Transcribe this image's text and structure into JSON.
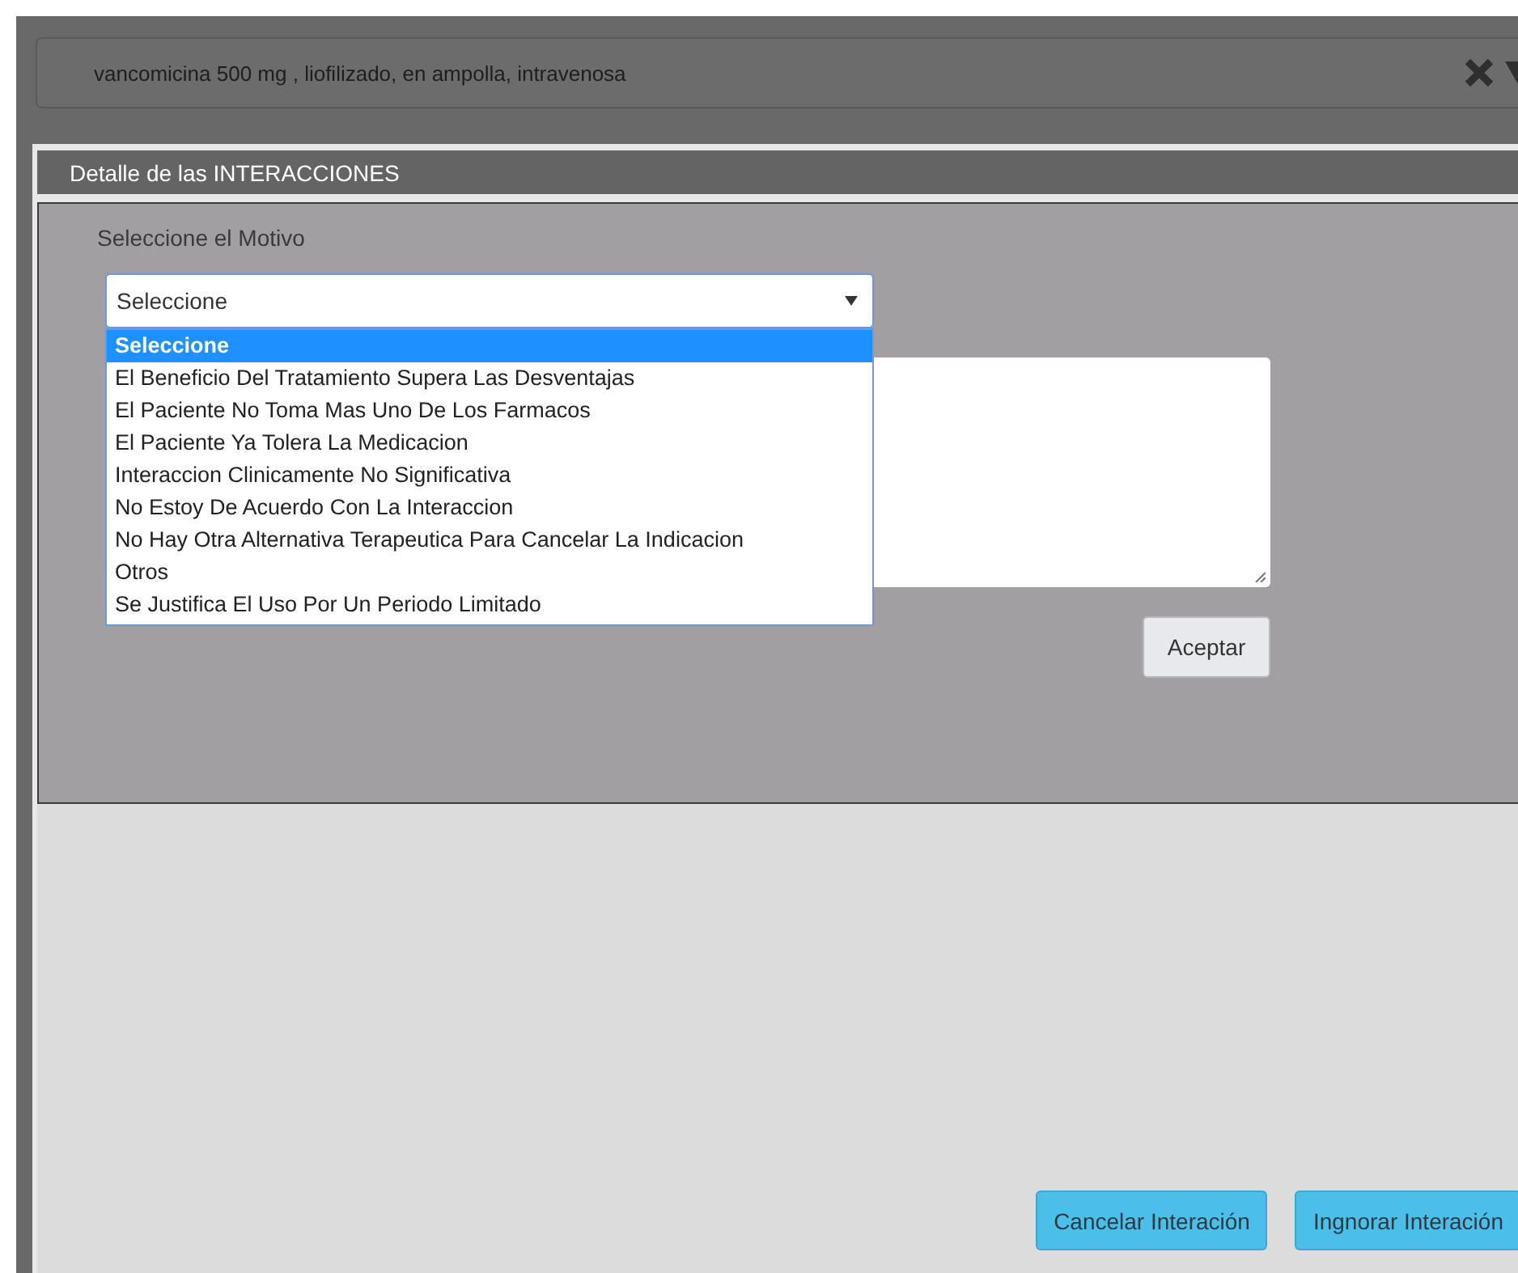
{
  "header": {
    "medication": "vancomicina 500 mg , liofilizado, en ampolla, intravenosa"
  },
  "dialog": {
    "title": "Detalle de las INTERACCIONES",
    "form": {
      "label": "Seleccione el Motivo",
      "select_value": "Seleccione",
      "options": [
        {
          "label": "Seleccione",
          "selected": true
        },
        {
          "label": "El Beneficio Del Tratamiento Supera Las Desventajas",
          "selected": false
        },
        {
          "label": "El Paciente No Toma Mas Uno De Los Farmacos",
          "selected": false
        },
        {
          "label": "El Paciente Ya Tolera La Medicacion",
          "selected": false
        },
        {
          "label": "Interaccion Clinicamente No Significativa",
          "selected": false
        },
        {
          "label": "No Estoy De Acuerdo Con La Interaccion",
          "selected": false
        },
        {
          "label": "No Hay Otra Alternativa Terapeutica Para Cancelar La Indicacion",
          "selected": false
        },
        {
          "label": "Otros",
          "selected": false
        },
        {
          "label": "Se Justifica El Uso Por Un Periodo Limitado",
          "selected": false
        }
      ],
      "accept_button": "Aceptar"
    }
  },
  "footer_buttons": [
    "Cancelar Interación",
    "Ingnorar Interación"
  ]
}
